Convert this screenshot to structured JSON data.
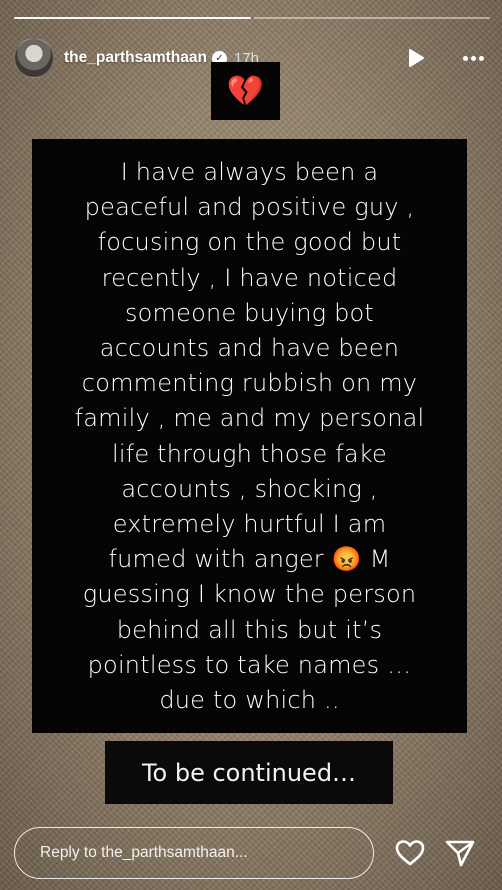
{
  "story": {
    "progress_segments": 2,
    "progress_done": 1
  },
  "header": {
    "username": "the_parthsamthaan",
    "time": "17h",
    "verified_icon": "verified-badge-icon",
    "play_icon": "play-icon",
    "more_icon": "more-options-icon"
  },
  "content": {
    "emoji_box": "💔",
    "main_text": "I have always been a\npeaceful and positive guy ,\nfocusing on the good but\nrecently , I have noticed\nsomeone buying bot\naccounts and have been\ncommenting rubbish on my\nfamily , me and my personal\nlife through those fake\naccounts , shocking ,\nextremely hurtful I am\nfumed with anger 😡 M\nguessing I know the person\nbehind all this but it’s\npointless to take names …\ndue to which ..",
    "continue_text": "To be continued…"
  },
  "footer": {
    "reply_placeholder": "Reply to the_parthsamthaan...",
    "like_icon": "heart-outline-icon",
    "share_icon": "send-icon"
  }
}
